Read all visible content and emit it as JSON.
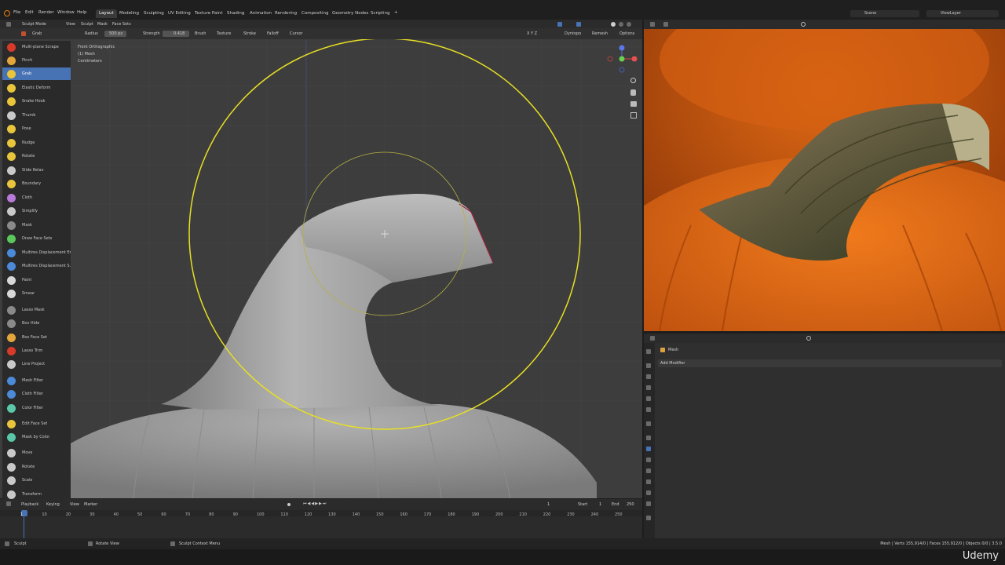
{
  "menus": [
    "File",
    "Edit",
    "Render",
    "Window",
    "Help"
  ],
  "workspaces": [
    "Layout",
    "Modeling",
    "Sculpting",
    "UV Editing",
    "Texture Paint",
    "Shading",
    "Animation",
    "Rendering",
    "Compositing",
    "Geometry Nodes",
    "Scripting"
  ],
  "active_workspace": "Layout",
  "scene": {
    "label": "Scene",
    "view_layer": "ViewLayer"
  },
  "viewport_header": {
    "mode": "Sculpt Mode",
    "menus": [
      "View",
      "Sculpt",
      "Mask",
      "Face Sets"
    ]
  },
  "tool_options": {
    "brush_name": "Grab",
    "radius_label": "Radius",
    "radius_value": "500 px",
    "strength_label": "Strength",
    "strength_value": "0.418",
    "dropdowns": [
      "Brush",
      "Texture",
      "Stroke",
      "Falloff",
      "Cursor"
    ],
    "axes": "X Y Z",
    "dyntopo": "Dyntopo",
    "remesh": "Remesh",
    "options": "Options"
  },
  "overlay_info": [
    "Front Orthographic",
    "(1) Mesh",
    "Centimeters"
  ],
  "tools": [
    {
      "label": "Multi-plane Scrape",
      "color": "#d83a2a"
    },
    {
      "label": "Pinch",
      "color": "#e3a63a"
    },
    {
      "label": "Grab",
      "color": "#e8c53a"
    },
    {
      "label": "Elastic Deform",
      "color": "#e8c53a"
    },
    {
      "label": "Snake Hook",
      "color": "#e8c53a"
    },
    {
      "label": "Thumb",
      "color": "#c9c9c9"
    },
    {
      "label": "Pose",
      "color": "#e8c53a"
    },
    {
      "label": "Nudge",
      "color": "#e8c53a"
    },
    {
      "label": "Rotate",
      "color": "#e8c53a"
    },
    {
      "label": "Slide Relax",
      "color": "#c9c9c9"
    },
    {
      "label": "Boundary",
      "color": "#e8c53a"
    },
    {
      "label": "Cloth",
      "color": "#b77ad8"
    },
    {
      "label": "Simplify",
      "color": "#c9c9c9"
    },
    {
      "label": "Mask",
      "color": "#8a8a8a"
    },
    {
      "label": "Draw Face Sets",
      "color": "#5ac85a"
    },
    {
      "label": "Multires Displacement Er...",
      "color": "#4a8ad8"
    },
    {
      "label": "Multires Displacement S...",
      "color": "#4a8ad8"
    },
    {
      "label": "Paint",
      "color": "#d8d8d8"
    },
    {
      "label": "Smear",
      "color": "#d8d8d8"
    },
    {
      "label": "Lasso Mask",
      "color": "#8a8a8a"
    },
    {
      "label": "Box Hide",
      "color": "#8a8a8a"
    },
    {
      "label": "Box Face Set",
      "color": "#e3a63a"
    },
    {
      "label": "Lasso Trim",
      "color": "#d83a2a"
    },
    {
      "label": "Line Project",
      "color": "#c9c9c9"
    },
    {
      "label": "Mesh Filter",
      "color": "#4a8ad8"
    },
    {
      "label": "Cloth Filter",
      "color": "#4a8ad8"
    },
    {
      "label": "Color Filter",
      "color": "#5ac8a8"
    },
    {
      "label": "Edit Face Set",
      "color": "#e8c53a"
    },
    {
      "label": "Mask by Color",
      "color": "#5ac8a8"
    },
    {
      "label": "Move",
      "color": "#c9c9c9"
    },
    {
      "label": "Rotate",
      "color": "#c9c9c9"
    },
    {
      "label": "Scale",
      "color": "#c9c9c9"
    },
    {
      "label": "Transform",
      "color": "#c9c9c9"
    }
  ],
  "properties": {
    "object": "Mesh",
    "add_modifier": "Add Modifier"
  },
  "timeline": {
    "menus": [
      "Playback",
      "Keying",
      "View",
      "Marker"
    ],
    "current_frame": "1",
    "start_label": "Start",
    "start": "1",
    "end_label": "End",
    "end": "250",
    "ticks": [
      "1",
      "10",
      "20",
      "30",
      "40",
      "50",
      "60",
      "70",
      "80",
      "90",
      "100",
      "110",
      "120",
      "130",
      "140",
      "150",
      "160",
      "170",
      "180",
      "190",
      "200",
      "210",
      "220",
      "230",
      "240",
      "250"
    ]
  },
  "status": {
    "left": "Sculpt",
    "middle": "Rotate View",
    "context": "Sculpt Context Menu",
    "right": "Mesh | Verts 155,914/0 | Faces 155,912/0 | Objects 0/0 | 3.5.0"
  },
  "watermark": "Udemy"
}
